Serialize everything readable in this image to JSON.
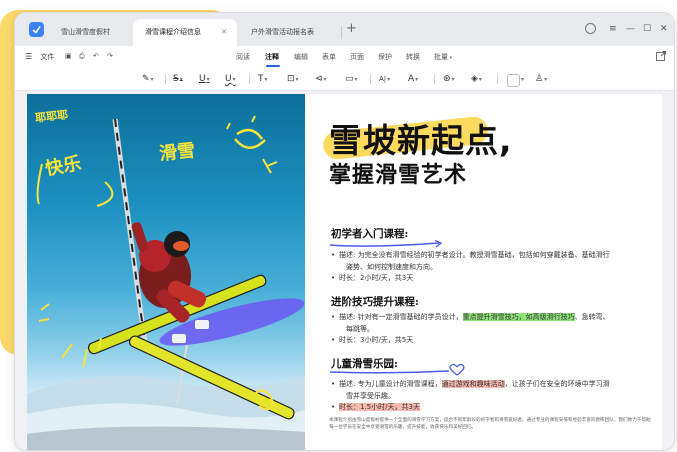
{
  "tabs": [
    {
      "label": "雪山滑雪度假村",
      "active": false
    },
    {
      "label": "滑雪课程介绍信息",
      "active": true
    },
    {
      "label": "户外滑雪活动报名表",
      "active": false
    }
  ],
  "menu": {
    "file": "文件",
    "items": [
      "阅读",
      "注释",
      "编辑",
      "表单",
      "页面",
      "保护",
      "转换",
      "批量"
    ],
    "active": "注释"
  },
  "colors": {
    "accent": "#2563eb",
    "highlight_yellow": "#fbe89a",
    "highlight_green": "#8ee27a",
    "highlight_red": "#f7b9b0",
    "brush_yellow": "#fcd54e"
  },
  "photo": {
    "badge": "耶耶耶",
    "word1": "快乐",
    "word2": "滑雪"
  },
  "hero": {
    "line1": "雪坡新起点,",
    "line2": "掌握滑雪艺术"
  },
  "sections": [
    {
      "heading": "初学者入门课程:",
      "desc_label": "描述:",
      "desc": "为完全没有滑雪经验的初学者设计。教授滑雪基础，包括如何穿戴装备、基础滑行",
      "desc_cont": "姿势、如何控制速度和方向。",
      "duration": "时长：2小时/天，共3天"
    },
    {
      "heading": "进阶技巧提升课程:",
      "desc_label": "描述:",
      "desc_pre": "针对有一定滑雪基础的学员设计，",
      "desc_hl": "重点提升滑雪技巧，如高级滑行技巧",
      "desc_post": "、急转弯、",
      "desc_cont": "每跳等。",
      "duration": "时长：3小时/天，共5天"
    },
    {
      "heading": "儿童滑雪乐园:",
      "desc_label": "描述:",
      "desc_pre": "专为儿童设计的滑雪课程，",
      "desc_hl": "通过游戏和趣味活动",
      "desc_post": "，让孩子们在安全的环境中学习滑",
      "desc_cont": "雪并享受乐趣。",
      "duration": "时长：1.5小时/天，共3天"
    }
  ],
  "footnote": "本课程介绍由雪山度假村提供一个全面的滑雪学习方案，适合不同年龄段的初学者和滑雪爱好者。通过专业的课程安排和经验丰富的教练团队，我们致力于帮助每一位学员在安全中享受滑雪的乐趣，提升技能，收获快乐和美好回忆。"
}
